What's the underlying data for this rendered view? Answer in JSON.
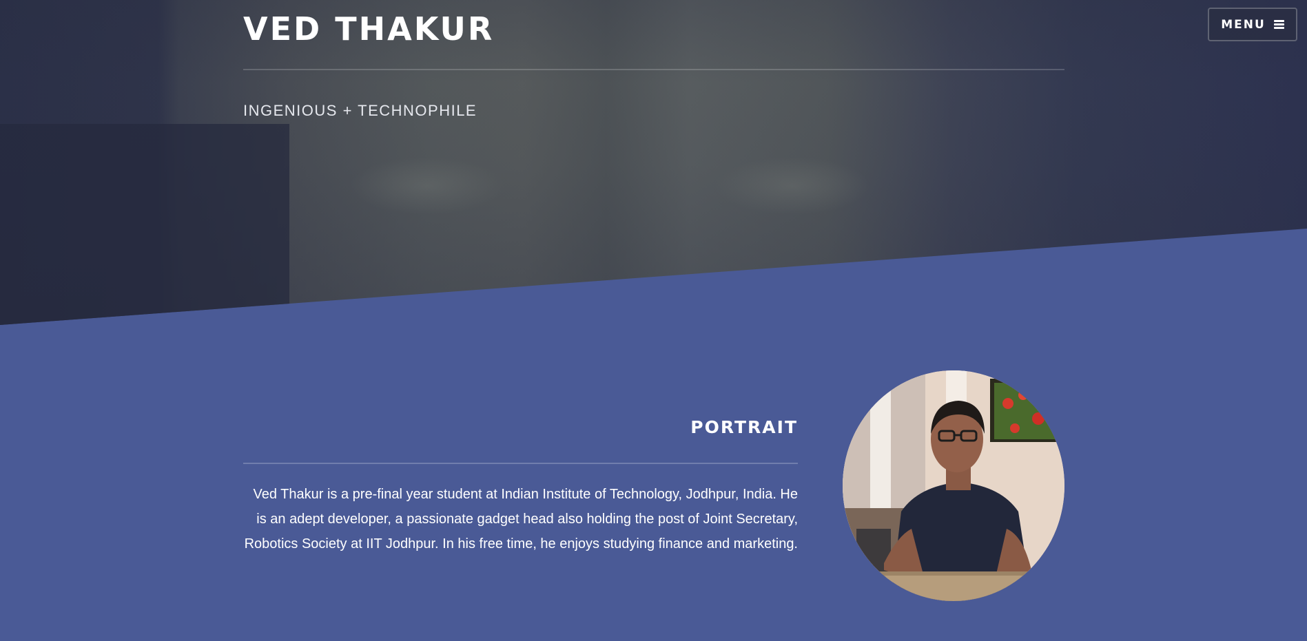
{
  "header": {
    "title": "VED THAKUR",
    "tagline": "INGENIOUS + TECHNOPHILE"
  },
  "nav": {
    "menu_label": "MENU",
    "menu_icon": "hamburger-icon"
  },
  "about": {
    "heading": "PORTRAIT",
    "bio": "Ved Thakur is a pre-final year student at Indian Institute of Technology, Jodhpur, India. He is an adept developer, a passionate gadget head also holding the post of Joint Secretary, Robotics Society at IIT Jodhpur. In his free time, he enjoys studying finance and marketing."
  },
  "colors": {
    "section_background": "#4a5a96",
    "hero_overlay": "#2b3048",
    "text": "#ffffff"
  }
}
